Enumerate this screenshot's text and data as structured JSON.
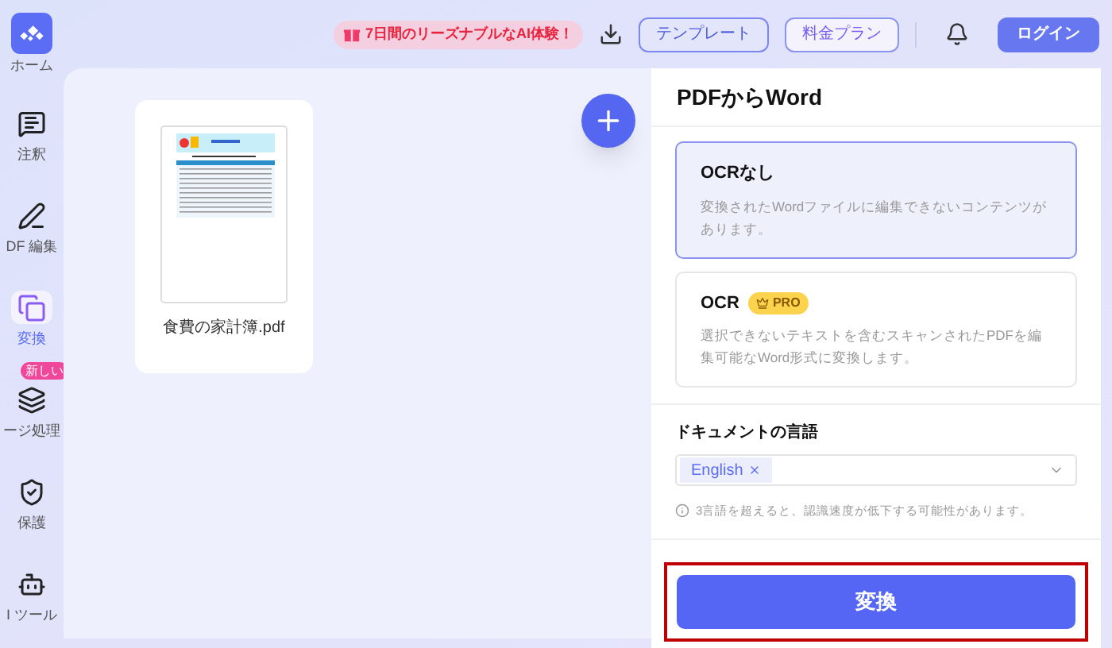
{
  "sidebar": {
    "items": [
      {
        "kind": "logo",
        "label": "ホーム",
        "selected": false
      },
      {
        "kind": "annotate",
        "label": "注釈",
        "selected": false
      },
      {
        "kind": "edit",
        "label": "DF 編集",
        "selected": false
      },
      {
        "kind": "convert",
        "label": "変換",
        "selected": true
      },
      {
        "kind": "pages",
        "label": "ージ処理",
        "selected": false,
        "badge": "新しい"
      },
      {
        "kind": "protect",
        "label": "保護",
        "selected": false
      },
      {
        "kind": "ai",
        "label": "I ツール",
        "selected": false
      }
    ]
  },
  "topbar": {
    "promo": "7日間のリーズナブルなAI体験！",
    "template_button": "テンプレート",
    "pricing_button": "料金プラン",
    "login_button": "ログイン"
  },
  "files": [
    {
      "name": "食費の家計簿.pdf"
    }
  ],
  "panel": {
    "title": "PDFからWord",
    "options": [
      {
        "title": "OCRなし",
        "description": "変換されたWordファイルに編集できないコンテンツがあります。",
        "selected": true
      },
      {
        "title": "OCR",
        "badge": "PRO",
        "description": "選択できないテキストを含むスキャンされたPDFを編集可能なWord形式に変換します。",
        "selected": false
      }
    ],
    "language_label": "ドキュメントの言語",
    "languages": [
      "English"
    ],
    "hint": "3言語を超えると、認識速度が低下する可能性があります。",
    "convert_button": "変換",
    "convert_highlighted": true
  }
}
